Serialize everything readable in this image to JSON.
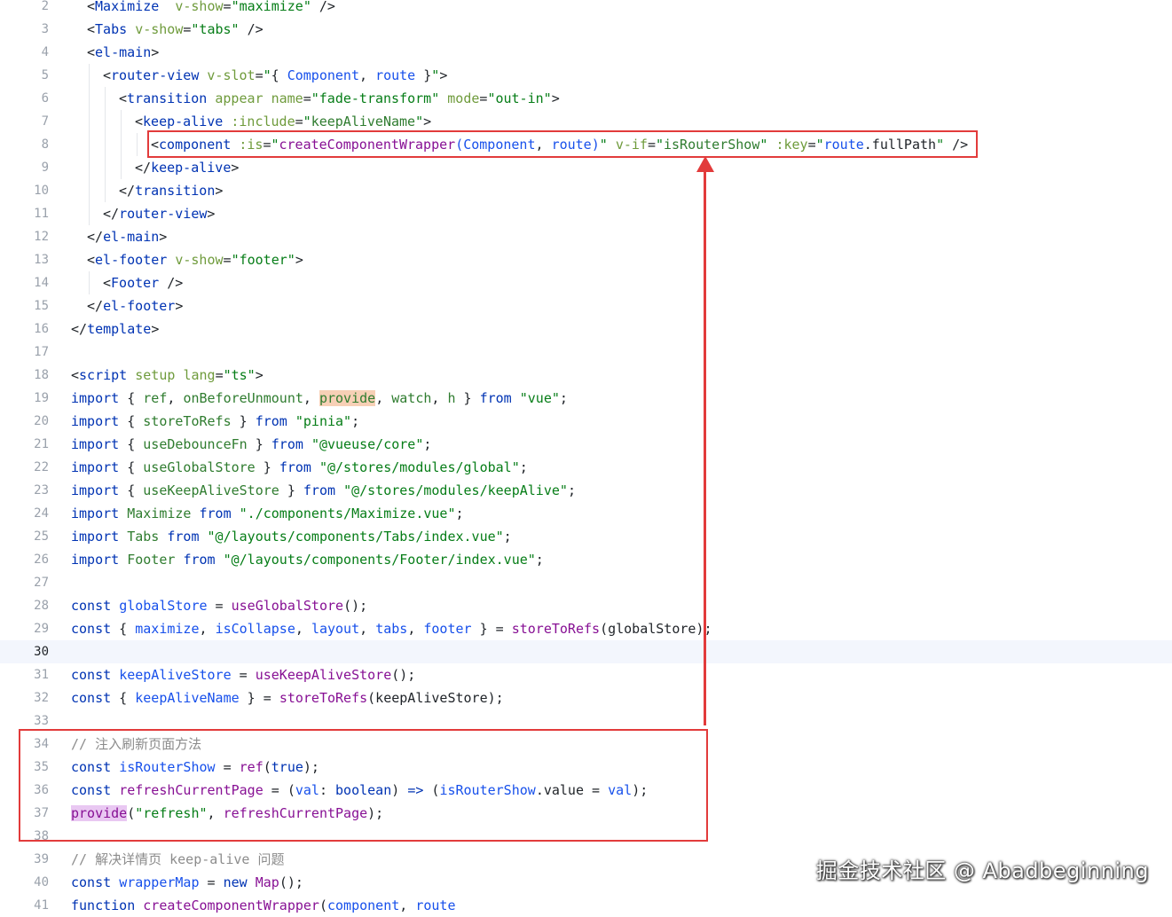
{
  "editor": {
    "active_line": 30,
    "lines": [
      {
        "n": 2,
        "tokens": [
          [
            "brk",
            "<"
          ],
          [
            "tag",
            "Maximize"
          ],
          [
            "",
            "  "
          ],
          [
            "dir",
            "v-show"
          ],
          [
            "",
            "="
          ],
          [
            "str",
            "\"maximize\""
          ],
          [
            "",
            " "
          ],
          [
            "brk",
            "/>"
          ]
        ]
      },
      {
        "n": 3,
        "tokens": [
          [
            "brk",
            "<"
          ],
          [
            "tag",
            "Tabs"
          ],
          [
            "",
            " "
          ],
          [
            "dir",
            "v-show"
          ],
          [
            "",
            "="
          ],
          [
            "str",
            "\"tabs\""
          ],
          [
            "",
            " "
          ],
          [
            "brk",
            "/>"
          ]
        ]
      },
      {
        "n": 4,
        "tokens": [
          [
            "brk",
            "<"
          ],
          [
            "tag",
            "el-main"
          ],
          [
            "brk",
            ">"
          ]
        ]
      },
      {
        "n": 5,
        "tokens": [
          [
            "brk",
            "<"
          ],
          [
            "tag",
            "router-view"
          ],
          [
            "",
            " "
          ],
          [
            "dir",
            "v-slot"
          ],
          [
            "",
            "="
          ],
          [
            "str",
            "\""
          ],
          [
            "brk",
            "{ "
          ],
          [
            "attr",
            "Component"
          ],
          [
            "",
            ", "
          ],
          [
            "attr",
            "route"
          ],
          [
            "brk",
            " }"
          ],
          [
            "str",
            "\""
          ],
          [
            "brk",
            ">"
          ]
        ]
      },
      {
        "n": 6,
        "tokens": [
          [
            "brk",
            "<"
          ],
          [
            "tag",
            "transition"
          ],
          [
            "",
            " "
          ],
          [
            "dir",
            "appear"
          ],
          [
            "",
            " "
          ],
          [
            "dir",
            "name"
          ],
          [
            "",
            "="
          ],
          [
            "str",
            "\"fade-transform\""
          ],
          [
            "",
            " "
          ],
          [
            "dir",
            "mode"
          ],
          [
            "",
            "="
          ],
          [
            "str",
            "\"out-in\""
          ],
          [
            "brk",
            ">"
          ]
        ]
      },
      {
        "n": 7,
        "tokens": [
          [
            "brk",
            "<"
          ],
          [
            "tag",
            "keep-alive"
          ],
          [
            "",
            " "
          ],
          [
            "dir",
            ":include"
          ],
          [
            "",
            "="
          ],
          [
            "str",
            "\""
          ],
          [
            "ident",
            "keepAliveName"
          ],
          [
            "str",
            "\""
          ],
          [
            "brk",
            ">"
          ]
        ]
      },
      {
        "n": 8,
        "tokens": [
          [
            "brk",
            "<"
          ],
          [
            "tag",
            "component"
          ],
          [
            "",
            " "
          ],
          [
            "dir",
            ":is"
          ],
          [
            "",
            "="
          ],
          [
            "str",
            "\""
          ],
          [
            "var",
            "createComponentWrapper"
          ],
          [
            "attr",
            "(Component"
          ],
          [
            "",
            ", "
          ],
          [
            "attr",
            "route)"
          ],
          [
            "str",
            "\""
          ],
          [
            "",
            " "
          ],
          [
            "dir",
            "v-if"
          ],
          [
            "",
            "="
          ],
          [
            "str",
            "\""
          ],
          [
            "ident",
            "isRouterShow"
          ],
          [
            "str",
            "\""
          ],
          [
            "",
            " "
          ],
          [
            "dir",
            ":key"
          ],
          [
            "",
            "="
          ],
          [
            "str",
            "\""
          ],
          [
            "attr",
            "route"
          ],
          [
            "",
            ".fullPath"
          ],
          [
            "str",
            "\""
          ],
          [
            "",
            " "
          ],
          [
            "brk",
            "/>"
          ]
        ]
      },
      {
        "n": 9,
        "tokens": [
          [
            "brk",
            "</"
          ],
          [
            "tag",
            "keep-alive"
          ],
          [
            "brk",
            ">"
          ]
        ]
      },
      {
        "n": 10,
        "tokens": [
          [
            "brk",
            "</"
          ],
          [
            "tag",
            "transition"
          ],
          [
            "brk",
            ">"
          ]
        ]
      },
      {
        "n": 11,
        "tokens": [
          [
            "brk",
            "</"
          ],
          [
            "tag",
            "router-view"
          ],
          [
            "brk",
            ">"
          ]
        ]
      },
      {
        "n": 12,
        "tokens": [
          [
            "brk",
            "</"
          ],
          [
            "tag",
            "el-main"
          ],
          [
            "brk",
            ">"
          ]
        ]
      },
      {
        "n": 13,
        "tokens": [
          [
            "brk",
            "<"
          ],
          [
            "tag",
            "el-footer"
          ],
          [
            "",
            " "
          ],
          [
            "dir",
            "v-show"
          ],
          [
            "",
            "="
          ],
          [
            "str",
            "\"footer\""
          ],
          [
            "brk",
            ">"
          ]
        ]
      },
      {
        "n": 14,
        "tokens": [
          [
            "brk",
            "<"
          ],
          [
            "tag",
            "Footer"
          ],
          [
            "",
            " "
          ],
          [
            "brk",
            "/>"
          ]
        ]
      },
      {
        "n": 15,
        "tokens": [
          [
            "brk",
            "</"
          ],
          [
            "tag",
            "el-footer"
          ],
          [
            "brk",
            ">"
          ]
        ]
      },
      {
        "n": 16,
        "tokens": [
          [
            "brk",
            "</"
          ],
          [
            "tag",
            "template"
          ],
          [
            "brk",
            ">"
          ]
        ]
      },
      {
        "n": 17,
        "tokens": []
      },
      {
        "n": 18,
        "tokens": [
          [
            "brk",
            "<"
          ],
          [
            "tag",
            "script"
          ],
          [
            "",
            " "
          ],
          [
            "dir",
            "setup"
          ],
          [
            "",
            " "
          ],
          [
            "dir",
            "lang"
          ],
          [
            "",
            "="
          ],
          [
            "str",
            "\"ts\""
          ],
          [
            "brk",
            ">"
          ]
        ]
      },
      {
        "n": 19,
        "tokens": [
          [
            "kw",
            "import"
          ],
          [
            "brk",
            " { "
          ],
          [
            "ident",
            "ref"
          ],
          [
            "",
            ", "
          ],
          [
            "ident",
            "onBeforeUnmount"
          ],
          [
            "",
            ", "
          ],
          [
            "hl",
            "provide"
          ],
          [
            "",
            ", "
          ],
          [
            "ident",
            "watch"
          ],
          [
            "",
            ", "
          ],
          [
            "ident",
            "h"
          ],
          [
            "brk",
            " } "
          ],
          [
            "kw",
            "from"
          ],
          [
            "",
            " "
          ],
          [
            "str",
            "\"vue\""
          ],
          [
            "",
            ";"
          ]
        ]
      },
      {
        "n": 20,
        "tokens": [
          [
            "kw",
            "import"
          ],
          [
            "brk",
            " { "
          ],
          [
            "ident",
            "storeToRefs"
          ],
          [
            "brk",
            " } "
          ],
          [
            "kw",
            "from"
          ],
          [
            "",
            " "
          ],
          [
            "str",
            "\"pinia\""
          ],
          [
            "",
            ";"
          ]
        ]
      },
      {
        "n": 21,
        "tokens": [
          [
            "kw",
            "import"
          ],
          [
            "brk",
            " { "
          ],
          [
            "ident",
            "useDebounceFn"
          ],
          [
            "brk",
            " } "
          ],
          [
            "kw",
            "from"
          ],
          [
            "",
            " "
          ],
          [
            "str",
            "\"@vueuse/core\""
          ],
          [
            "",
            ";"
          ]
        ]
      },
      {
        "n": 22,
        "tokens": [
          [
            "kw",
            "import"
          ],
          [
            "brk",
            " { "
          ],
          [
            "ident",
            "useGlobalStore"
          ],
          [
            "brk",
            " } "
          ],
          [
            "kw",
            "from"
          ],
          [
            "",
            " "
          ],
          [
            "str",
            "\"@/stores/modules/global\""
          ],
          [
            "",
            ";"
          ]
        ]
      },
      {
        "n": 23,
        "tokens": [
          [
            "kw",
            "import"
          ],
          [
            "brk",
            " { "
          ],
          [
            "ident",
            "useKeepAliveStore"
          ],
          [
            "brk",
            " } "
          ],
          [
            "kw",
            "from"
          ],
          [
            "",
            " "
          ],
          [
            "str",
            "\"@/stores/modules/keepAlive\""
          ],
          [
            "",
            ";"
          ]
        ]
      },
      {
        "n": 24,
        "tokens": [
          [
            "kw",
            "import"
          ],
          [
            "",
            " "
          ],
          [
            "ident",
            "Maximize"
          ],
          [
            "",
            " "
          ],
          [
            "kw",
            "from"
          ],
          [
            "",
            " "
          ],
          [
            "str",
            "\"./components/Maximize.vue\""
          ],
          [
            "",
            ";"
          ]
        ]
      },
      {
        "n": 25,
        "tokens": [
          [
            "kw",
            "import"
          ],
          [
            "",
            " "
          ],
          [
            "ident",
            "Tabs"
          ],
          [
            "",
            " "
          ],
          [
            "kw",
            "from"
          ],
          [
            "",
            " "
          ],
          [
            "str",
            "\"@/layouts/components/Tabs/index.vue\""
          ],
          [
            "",
            ";"
          ]
        ]
      },
      {
        "n": 26,
        "tokens": [
          [
            "kw",
            "import"
          ],
          [
            "",
            " "
          ],
          [
            "ident",
            "Footer"
          ],
          [
            "",
            " "
          ],
          [
            "kw",
            "from"
          ],
          [
            "",
            " "
          ],
          [
            "str",
            "\"@/layouts/components/Footer/index.vue\""
          ],
          [
            "",
            ";"
          ]
        ]
      },
      {
        "n": 27,
        "tokens": []
      },
      {
        "n": 28,
        "tokens": [
          [
            "kw",
            "const"
          ],
          [
            "",
            " "
          ],
          [
            "attr",
            "globalStore"
          ],
          [
            "",
            " = "
          ],
          [
            "var",
            "useGlobalStore"
          ],
          [
            "",
            "();"
          ]
        ]
      },
      {
        "n": 29,
        "tokens": [
          [
            "kw",
            "const"
          ],
          [
            "brk",
            " { "
          ],
          [
            "attr",
            "maximize"
          ],
          [
            "",
            ", "
          ],
          [
            "attr",
            "isCollapse"
          ],
          [
            "",
            ", "
          ],
          [
            "attr",
            "layout"
          ],
          [
            "",
            ", "
          ],
          [
            "attr",
            "tabs"
          ],
          [
            "",
            ", "
          ],
          [
            "attr",
            "footer"
          ],
          [
            "brk",
            " }"
          ],
          [
            "",
            " = "
          ],
          [
            "var",
            "storeToRefs"
          ],
          [
            "",
            "(globalStore);"
          ]
        ]
      },
      {
        "n": 30,
        "tokens": []
      },
      {
        "n": 31,
        "tokens": [
          [
            "kw",
            "const"
          ],
          [
            "",
            " "
          ],
          [
            "attr",
            "keepAliveStore"
          ],
          [
            "",
            " = "
          ],
          [
            "var",
            "useKeepAliveStore"
          ],
          [
            "",
            "();"
          ]
        ]
      },
      {
        "n": 32,
        "tokens": [
          [
            "kw",
            "const"
          ],
          [
            "brk",
            " { "
          ],
          [
            "attr",
            "keepAliveName"
          ],
          [
            "brk",
            " }"
          ],
          [
            "",
            " = "
          ],
          [
            "var",
            "storeToRefs"
          ],
          [
            "",
            "(keepAliveStore);"
          ]
        ]
      },
      {
        "n": 33,
        "tokens": []
      },
      {
        "n": 34,
        "tokens": [
          [
            "cmt",
            "// 注入刷新页面方法"
          ]
        ]
      },
      {
        "n": 35,
        "tokens": [
          [
            "kw",
            "const"
          ],
          [
            "",
            " "
          ],
          [
            "attr",
            "isRouterShow"
          ],
          [
            "",
            " = "
          ],
          [
            "var",
            "ref"
          ],
          [
            "",
            "("
          ],
          [
            "kw",
            "true"
          ],
          [
            "",
            ");"
          ]
        ]
      },
      {
        "n": 36,
        "tokens": [
          [
            "kw",
            "const"
          ],
          [
            "",
            " "
          ],
          [
            "var",
            "refreshCurrentPage"
          ],
          [
            "",
            " = ("
          ],
          [
            "attr",
            "val"
          ],
          [
            "",
            ": "
          ],
          [
            "kw",
            "boolean"
          ],
          [
            "",
            ") "
          ],
          [
            "kw",
            "=>"
          ],
          [
            "",
            " ("
          ],
          [
            "attr",
            "isRouterShow"
          ],
          [
            "",
            ".value = "
          ],
          [
            "attr",
            "val"
          ],
          [
            "",
            ");"
          ]
        ]
      },
      {
        "n": 37,
        "tokens": [
          [
            "hlp",
            "provide"
          ],
          [
            "",
            "("
          ],
          [
            "str",
            "\"refresh\""
          ],
          [
            "",
            ", "
          ],
          [
            "var",
            "refreshCurrentPage"
          ],
          [
            "",
            ");"
          ]
        ]
      },
      {
        "n": 38,
        "tokens": []
      },
      {
        "n": 39,
        "tokens": [
          [
            "cmt",
            "// 解决详情页 keep-alive 问题"
          ]
        ]
      },
      {
        "n": 40,
        "tokens": [
          [
            "kw",
            "const"
          ],
          [
            "",
            " "
          ],
          [
            "attr",
            "wrapperMap"
          ],
          [
            "",
            " = "
          ],
          [
            "kw",
            "new"
          ],
          [
            "",
            " "
          ],
          [
            "var",
            "Map"
          ],
          [
            "",
            "();"
          ]
        ]
      },
      {
        "n": 41,
        "tokens": [
          [
            "kw",
            "function"
          ],
          [
            "",
            " "
          ],
          [
            "var",
            "createComponentWrapper"
          ],
          [
            "",
            "("
          ],
          [
            "attr",
            "component"
          ],
          [
            "",
            ", "
          ],
          [
            "attr",
            "route"
          ],
          [
            ") {"
          ]
        ]
      }
    ]
  },
  "watermark": "掘金技术社区 @ Abadbeginning",
  "annotation_color": "#e23b3b"
}
